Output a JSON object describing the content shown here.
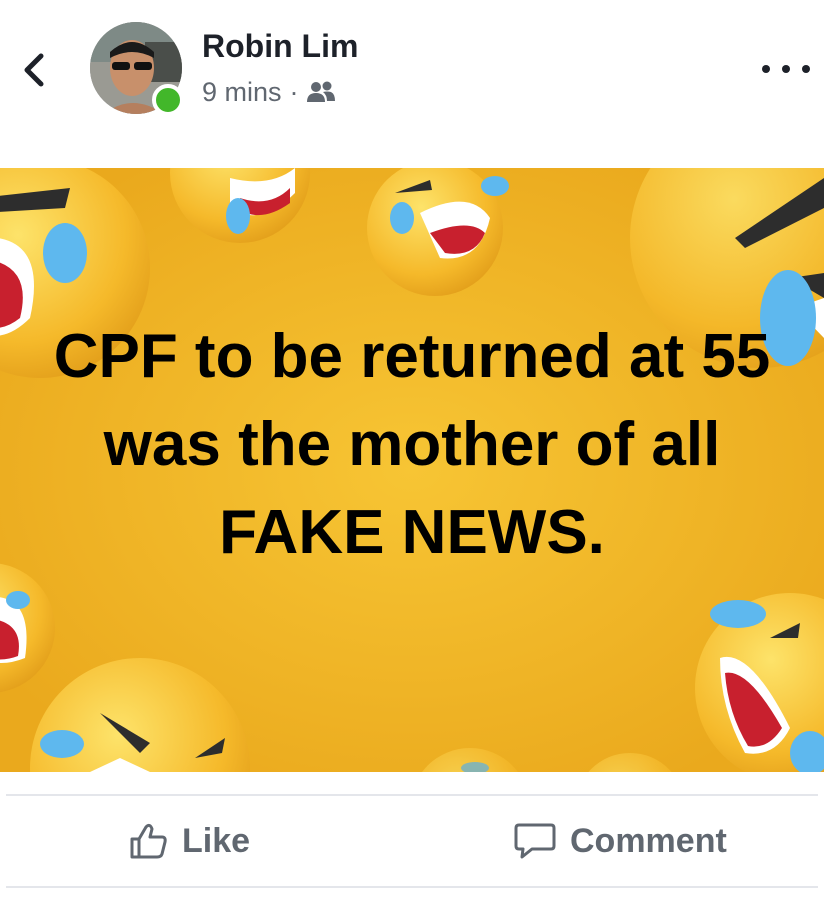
{
  "post": {
    "author": "Robin Lim",
    "time": "9 mins",
    "separator": "·",
    "audience_icon": "friends-icon",
    "online": true,
    "image_text": "CPF to be returned at 55 was the mother of all FAKE NEWS."
  },
  "icons": {
    "back": "chevron-left-icon",
    "more": "more-options-icon",
    "like": "thumbs-up-icon",
    "comment": "speech-bubble-icon"
  },
  "actions": {
    "like_label": "Like",
    "comment_label": "Comment"
  },
  "colors": {
    "background": "#f0b627",
    "emoji": "#f7c52f",
    "tear": "#5eb8ee",
    "online": "#42b72a",
    "action_text": "#606770"
  }
}
